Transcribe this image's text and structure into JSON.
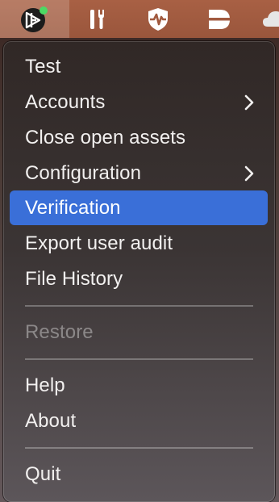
{
  "menubar": {
    "icons": [
      {
        "name": "app-logo-icon",
        "badge_color": "#4cd964"
      },
      {
        "name": "tools-icon"
      },
      {
        "name": "shield-pulse-icon"
      },
      {
        "name": "drive-icon"
      },
      {
        "name": "cloud-icon"
      }
    ]
  },
  "menu": {
    "items": [
      {
        "label": "Test",
        "has_submenu": false,
        "state": "normal"
      },
      {
        "label": "Accounts",
        "has_submenu": true,
        "state": "normal"
      },
      {
        "label": "Close open assets",
        "has_submenu": false,
        "state": "normal"
      },
      {
        "label": "Configuration",
        "has_submenu": true,
        "state": "normal"
      },
      {
        "label": "Verification",
        "has_submenu": false,
        "state": "highlighted"
      },
      {
        "label": "Export user audit",
        "has_submenu": false,
        "state": "normal"
      },
      {
        "label": "File History",
        "has_submenu": false,
        "state": "normal"
      },
      {
        "label": "Restore",
        "has_submenu": false,
        "state": "disabled"
      },
      {
        "label": "Help",
        "has_submenu": false,
        "state": "normal"
      },
      {
        "label": "About",
        "has_submenu": false,
        "state": "normal"
      },
      {
        "label": "Quit",
        "has_submenu": false,
        "state": "normal"
      }
    ]
  },
  "colors": {
    "menubar": "#a15a3f",
    "highlight": "#3a6fd8",
    "menu_text": "#f2f0ef",
    "disabled_text": "#9a9694"
  }
}
